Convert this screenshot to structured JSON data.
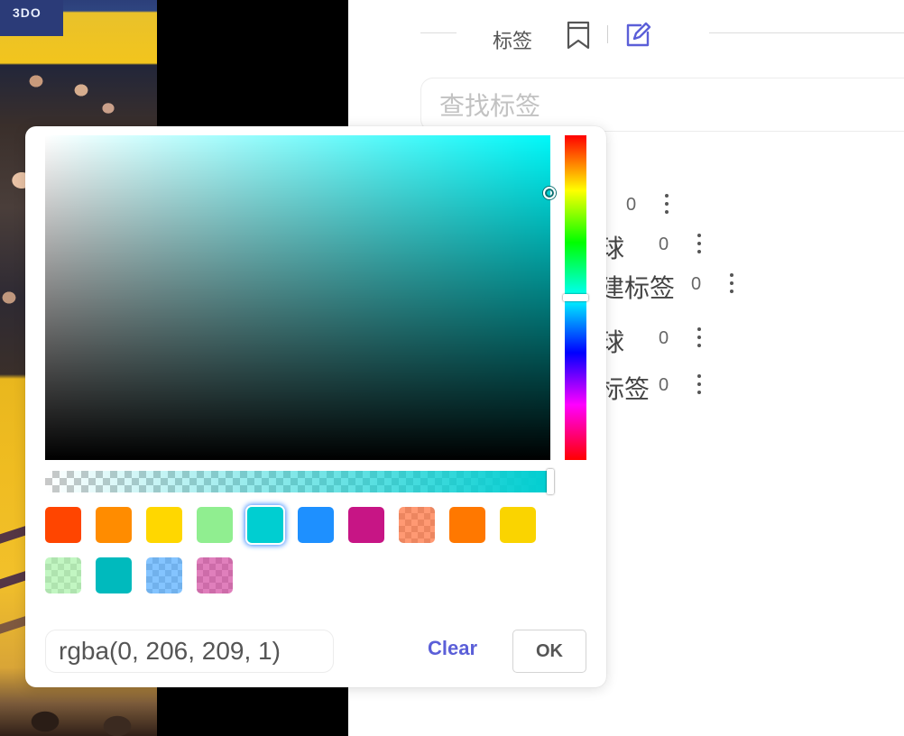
{
  "video": {
    "scoreboard_text": "3DO"
  },
  "tag_panel": {
    "title": "标签",
    "search_placeholder": "查找标签",
    "tags": [
      {
        "name": "",
        "count": "0"
      },
      {
        "name": "球",
        "count": "0"
      },
      {
        "name": "建标签",
        "count": "0"
      },
      {
        "name": "球",
        "count": "0"
      },
      {
        "name": "标签",
        "count": "0"
      }
    ]
  },
  "color_picker": {
    "selected_color": "#00CED1",
    "hue_position": 0.5,
    "alpha": 1,
    "value": "rgba(0, 206, 209, 1)",
    "clear_label": "Clear",
    "ok_label": "OK",
    "swatches": [
      {
        "color": "#FF4500",
        "translucent": false
      },
      {
        "color": "#FF8C00",
        "translucent": false
      },
      {
        "color": "#FFD700",
        "translucent": false
      },
      {
        "color": "#90EE90",
        "translucent": false
      },
      {
        "color": "#00CED1",
        "translucent": false,
        "selected": true
      },
      {
        "color": "#1E90FF",
        "translucent": false
      },
      {
        "color": "#C71585",
        "translucent": false
      },
      {
        "color": "#FF4500",
        "translucent": true
      },
      {
        "color": "#FF7800",
        "translucent": false
      },
      {
        "color": "#FAD400",
        "translucent": false
      },
      {
        "color": "#90EE90",
        "translucent": true
      },
      {
        "color": "#00BABD",
        "translucent": false
      },
      {
        "color": "#1F93FF",
        "translucent": true
      },
      {
        "color": "#C71585",
        "translucent": true
      }
    ]
  }
}
